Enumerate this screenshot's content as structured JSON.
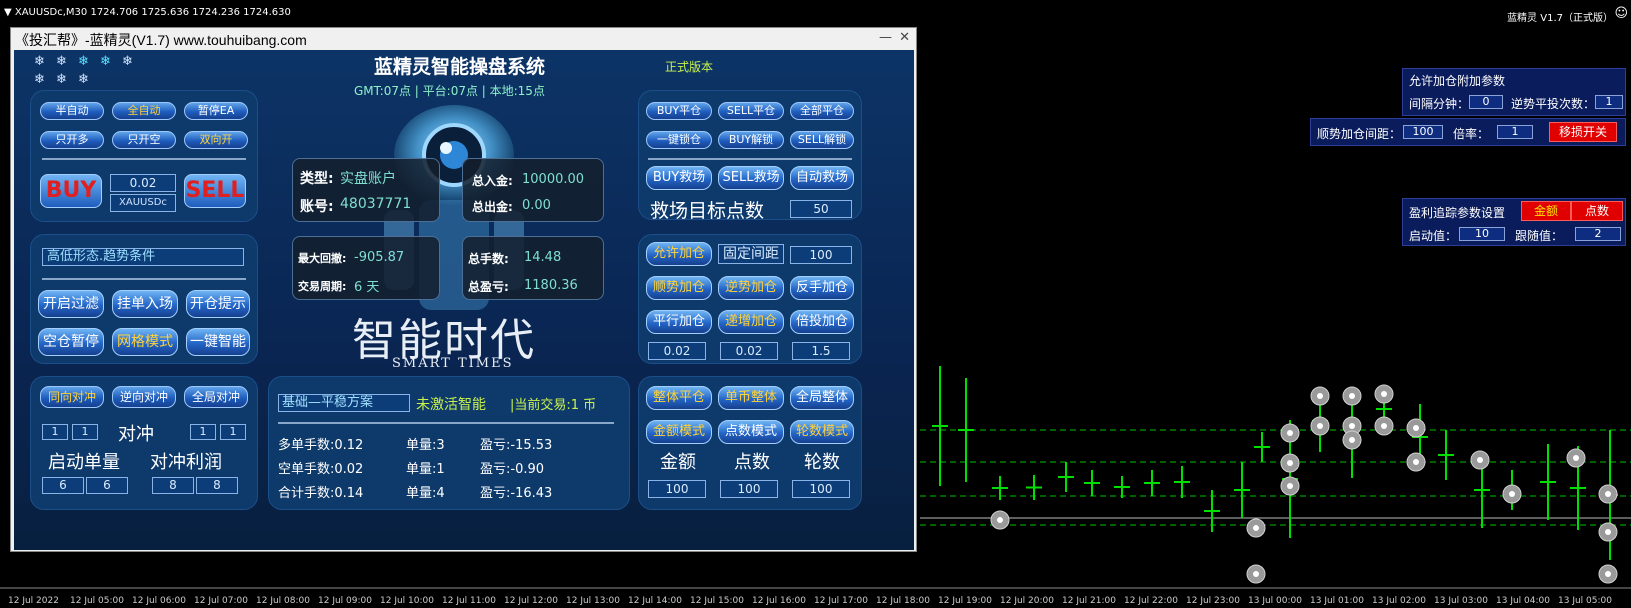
{
  "chart": {
    "symbol_info": "▼ XAUUSDc,M30  1724.706 1725.636 1724.236 1724.630",
    "ea_name": "蓝精灵 V1.7（正式版）",
    "smile_icon": "☺",
    "time_labels": [
      "12 Jul 2022",
      "12 Jul 05:00",
      "12 Jul 06:00",
      "12 Jul 07:00",
      "12 Jul 08:00",
      "12 Jul 09:00",
      "12 Jul 10:00",
      "12 Jul 11:00",
      "12 Jul 12:00",
      "12 Jul 13:00",
      "12 Jul 14:00",
      "12 Jul 15:00",
      "12 Jul 16:00",
      "12 Jul 17:00",
      "12 Jul 18:00",
      "12 Jul 19:00",
      "12 Jul 20:00",
      "12 Jul 21:00",
      "12 Jul 22:00",
      "12 Jul 23:00",
      "13 Jul 00:00",
      "13 Jul 01:00",
      "13 Jul 02:00",
      "13 Jul 03:00",
      "13 Jul 04:00",
      "13 Jul 05:00"
    ],
    "candle_color": "#00e000",
    "dashed_color": "#00c000"
  },
  "right_panels": {
    "p1_title": "允许加仓附加参数",
    "interval_label": "间隔分钟：",
    "interval_value": "0",
    "reverse_label": "逆势平投次数：",
    "reverse_value": "1",
    "trend_gap_label": "顺势加仓间距：",
    "trend_gap_value": "100",
    "multiplier_label": "倍率：",
    "multiplier_value": "1",
    "stoploss_btn": "移损开关",
    "p3_title": "盈利追踪参数设置",
    "amount_btn": "金额",
    "points_btn": "点数",
    "start_label": "启动值：",
    "start_value": "10",
    "follow_label": "跟随值：",
    "follow_value": "2"
  },
  "window": {
    "title": "《投汇帮》-蓝精灵(V1.7) www.touhuibang.com",
    "min": "—",
    "close": "✕"
  },
  "panel": {
    "stars": [
      "❄",
      "❄",
      "❄",
      "❄",
      "❄",
      "❄",
      "❄",
      "❄"
    ],
    "app_title": "蓝精灵智能操盘系统",
    "version": "正式版本",
    "time_line": "GMT:07点 | 平台:07点 | 本地:15点",
    "mode_buttons": [
      "半自动",
      "全自动",
      "暂停EA",
      "只开多",
      "只开空",
      "双向开"
    ],
    "buy": "BUY",
    "sell": "SELL",
    "lot": "0.02",
    "symbol": "XAUUSDc",
    "condition": "高低形态.趋势条件",
    "filter_buttons": [
      "开启过滤",
      "挂单入场",
      "开仓提示",
      "空仓暂停",
      "网格模式",
      "一键智能"
    ],
    "hedge_buttons": [
      "同向对冲",
      "逆向对冲",
      "全局对冲"
    ],
    "hedge_label": "对冲",
    "hedge_inputs": [
      "1",
      "1",
      "1",
      "1"
    ],
    "start_lot_label": "启动单量",
    "hedge_profit_label": "对冲利润",
    "bottom_inputs": [
      "6",
      "6",
      "8",
      "8"
    ],
    "account_type_label": "类型:",
    "account_type_value": "实盘账户",
    "account_label": "账号:",
    "account_value": "48037771",
    "deposit_label": "总入金:",
    "deposit_value": "10000.00",
    "withdraw_label": "总出金:",
    "withdraw_value": "0.00",
    "drawdown_label": "最大回撤:",
    "drawdown_value": "-905.87",
    "cycle_label": "交易周期:",
    "cycle_value": "6 天",
    "hands_label": "总手数:",
    "hands_value": "14.48",
    "profit_label": "总盈亏:",
    "profit_value": "1180.36",
    "logo_main": "智能时代",
    "logo_sub": "SMART TIMES",
    "scheme": "基础—平稳方案",
    "scheme_status": "未激活智能",
    "current_trade": "|当前交易:1 币",
    "stats": [
      [
        "多单手数:0.12",
        "单量:3",
        "盈亏:-15.53"
      ],
      [
        "空单手数:0.02",
        "单量:1",
        "盈亏:-0.90"
      ],
      [
        "合计手数:0.14",
        "单量:4",
        "盈亏:-16.43"
      ]
    ],
    "close_buttons": [
      "BUY平仓",
      "SELL平仓",
      "全部平仓",
      "一键锁仓",
      "BUY解锁",
      "SELL解锁"
    ],
    "rescue_buttons": [
      "BUY救场",
      "SELL救场",
      "自动救场"
    ],
    "rescue_target": "救场目标点数",
    "rescue_value": "50",
    "allow_add": "允许加仓",
    "fixed_gap": "固定间距",
    "fixed_gap_value": "100",
    "add_buttons": [
      "顺势加仓",
      "逆势加仓",
      "反手加仓",
      "平行加仓",
      "递增加仓",
      "倍投加仓"
    ],
    "add_values": [
      "0.02",
      "0.02",
      "1.5"
    ],
    "whole_buttons": [
      "整体平仓",
      "单币整体",
      "全局整体",
      "金额模式",
      "点数模式",
      "轮数模式"
    ],
    "mode_labels": [
      "金额",
      "点数",
      "轮数"
    ],
    "mode_values": [
      "100",
      "100",
      "100"
    ]
  }
}
